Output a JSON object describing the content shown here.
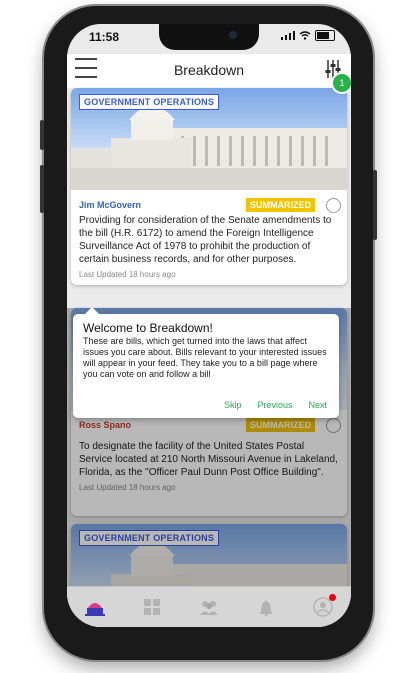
{
  "status": {
    "time": "11:58"
  },
  "header": {
    "title": "Breakdown",
    "filter_badge": "1"
  },
  "cards": [
    {
      "tag": "GOVERNMENT OPERATIONS",
      "sponsor": "Jim McGovern",
      "status_badge": "SUMMARIZED",
      "summary": "Providing for consideration of the Senate amendments to the bill (H.R. 6172) to amend the Foreign Intelligence Surveillance Act of 1978 to prohibit the production of certain business records, and for other purposes.",
      "updated": "Last Updated 18 hours ago"
    },
    {
      "sponsor": "Ross Spano",
      "status_badge": "SUMMARIZED",
      "summary": "To designate the facility of the United States Postal Service located at 210 North Missouri Avenue in Lakeland, Florida, as the \"Officer Paul Dunn Post Office Building\".",
      "updated": "Last Updated 18 hours ago"
    },
    {
      "tag": "GOVERNMENT OPERATIONS"
    }
  ],
  "tooltip": {
    "title": "Welcome to Breakdown!",
    "message": "These are bills, which get turned into the laws that affect issues you care about. Bills relevant to your interested issues will appear in your feed. They take you to a bill page where you can vote on and follow a bill",
    "skip": "Skip",
    "previous": "Previous",
    "next": "Next"
  },
  "colors": {
    "accent": "#2aa75a",
    "summarized": "#f2c300",
    "tag": "#3b5bdb"
  },
  "tabbar": {
    "icons": [
      "capitol-icon",
      "grid-icon",
      "people-icon",
      "bell-icon",
      "profile-icon"
    ]
  }
}
